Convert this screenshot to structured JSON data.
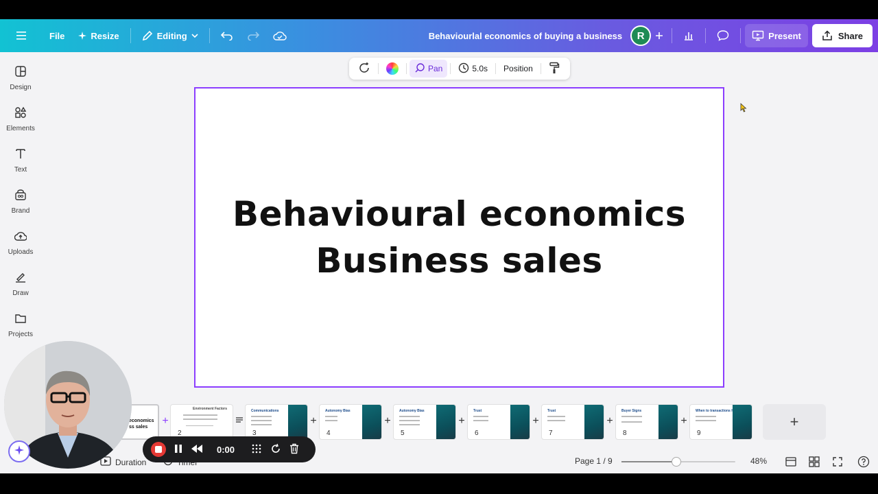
{
  "topbar": {
    "file_label": "File",
    "resize_label": "Resize",
    "editing_label": "Editing",
    "doc_title": "Behaviourlal economics of buying a business",
    "avatar_initial": "R",
    "present_label": "Present",
    "share_label": "Share"
  },
  "sidebar": {
    "items": [
      {
        "label": "Design",
        "icon": "design-icon"
      },
      {
        "label": "Elements",
        "icon": "elements-icon"
      },
      {
        "label": "Text",
        "icon": "text-icon"
      },
      {
        "label": "Brand",
        "icon": "brand-icon"
      },
      {
        "label": "Uploads",
        "icon": "uploads-icon"
      },
      {
        "label": "Draw",
        "icon": "draw-icon"
      },
      {
        "label": "Projects",
        "icon": "projects-icon"
      }
    ]
  },
  "context_toolbar": {
    "pan_label": "Pan",
    "duration_label": "5.0s",
    "position_label": "Position"
  },
  "slide": {
    "line1": "Behavioural economics",
    "line2": "Business sales"
  },
  "filmstrip": {
    "thumbs": [
      {
        "num": "1",
        "title": "economics\nss sales"
      },
      {
        "num": "2",
        "title": "Environment Factors"
      },
      {
        "num": "3",
        "title": "Communications"
      },
      {
        "num": "4",
        "title": "Autonomy Bias"
      },
      {
        "num": "5",
        "title": "Autonomy Bias"
      },
      {
        "num": "6",
        "title": "Trust"
      },
      {
        "num": "7",
        "title": "Trust"
      },
      {
        "num": "8",
        "title": "Buyer Signs"
      },
      {
        "num": "9",
        "title": "When to transactions happen?"
      }
    ],
    "add_page_label": "+"
  },
  "bottombar": {
    "duration_label": "Duration",
    "timer_label": "Timer",
    "page_indicator": "Page 1 / 9",
    "zoom_fraction": 0.48,
    "zoom_label": "48%"
  },
  "recorder": {
    "time": "0:00"
  },
  "colors": {
    "accent": "#8b3dff",
    "record_red": "#e53935"
  }
}
